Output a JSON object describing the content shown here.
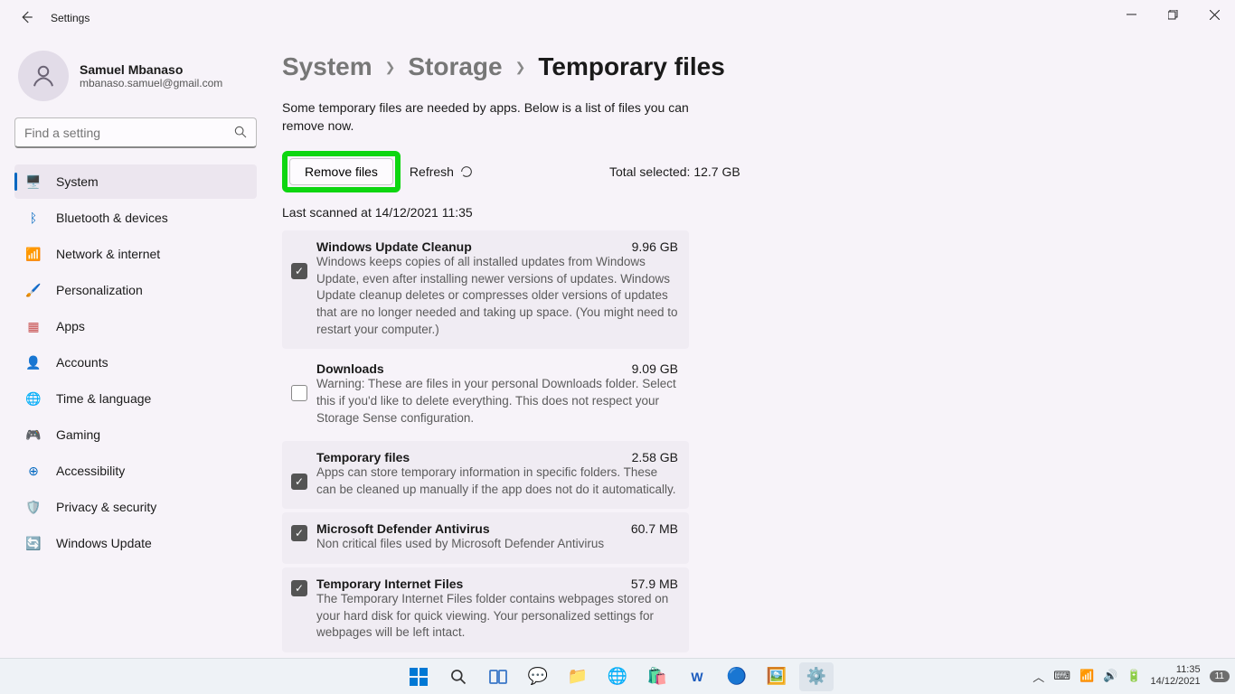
{
  "window": {
    "title": "Settings"
  },
  "profile": {
    "name": "Samuel Mbanaso",
    "email": "mbanaso.samuel@gmail.com"
  },
  "search": {
    "placeholder": "Find a setting"
  },
  "nav": [
    {
      "label": "System",
      "icon": "🖥️",
      "active": true
    },
    {
      "label": "Bluetooth & devices",
      "icon": "ᛒ",
      "color": "#0067c0"
    },
    {
      "label": "Network & internet",
      "icon": "📶",
      "color": "#0aa3dd"
    },
    {
      "label": "Personalization",
      "icon": "🖌️"
    },
    {
      "label": "Apps",
      "icon": "▦",
      "color": "#c75050"
    },
    {
      "label": "Accounts",
      "icon": "👤",
      "color": "#12a35f"
    },
    {
      "label": "Time & language",
      "icon": "🌐",
      "color": "#0aa3dd"
    },
    {
      "label": "Gaming",
      "icon": "🎮",
      "color": "#888"
    },
    {
      "label": "Accessibility",
      "icon": "⊕",
      "color": "#0067c0"
    },
    {
      "label": "Privacy & security",
      "icon": "🛡️",
      "color": "#888"
    },
    {
      "label": "Windows Update",
      "icon": "🔄",
      "color": "#0aa3dd"
    }
  ],
  "breadcrumb": {
    "l1": "System",
    "l2": "Storage",
    "l3": "Temporary files"
  },
  "page": {
    "description": "Some temporary files are needed by apps. Below is a list of files you can remove now.",
    "remove_label": "Remove files",
    "refresh_label": "Refresh",
    "total_label": "Total selected: 12.7 GB",
    "last_scanned": "Last scanned at 14/12/2021 11:35"
  },
  "items": [
    {
      "title": "Windows Update Cleanup",
      "size": "9.96 GB",
      "checked": true,
      "desc": "Windows keeps copies of all installed updates from Windows Update, even after installing newer versions of updates. Windows Update cleanup deletes or compresses older versions of updates that are no longer needed and taking up space. (You might need to restart your computer.)"
    },
    {
      "title": "Downloads",
      "size": "9.09 GB",
      "checked": false,
      "desc": "Warning: These are files in your personal Downloads folder. Select this if you'd like to delete everything. This does not respect your Storage Sense configuration."
    },
    {
      "title": "Temporary files",
      "size": "2.58 GB",
      "checked": true,
      "desc": "Apps can store temporary information in specific folders. These can be cleaned up manually if the app does not do it automatically."
    },
    {
      "title": "Microsoft Defender Antivirus",
      "size": "60.7 MB",
      "checked": true,
      "desc": "Non critical files used by Microsoft Defender Antivirus"
    },
    {
      "title": "Temporary Internet Files",
      "size": "57.9 MB",
      "checked": true,
      "desc": "The Temporary Internet Files folder contains webpages stored on your hard disk for quick viewing. Your personalized settings for webpages will be left intact."
    }
  ],
  "taskbar": {
    "time": "11:35",
    "date": "14/12/2021",
    "notifications": "11"
  }
}
